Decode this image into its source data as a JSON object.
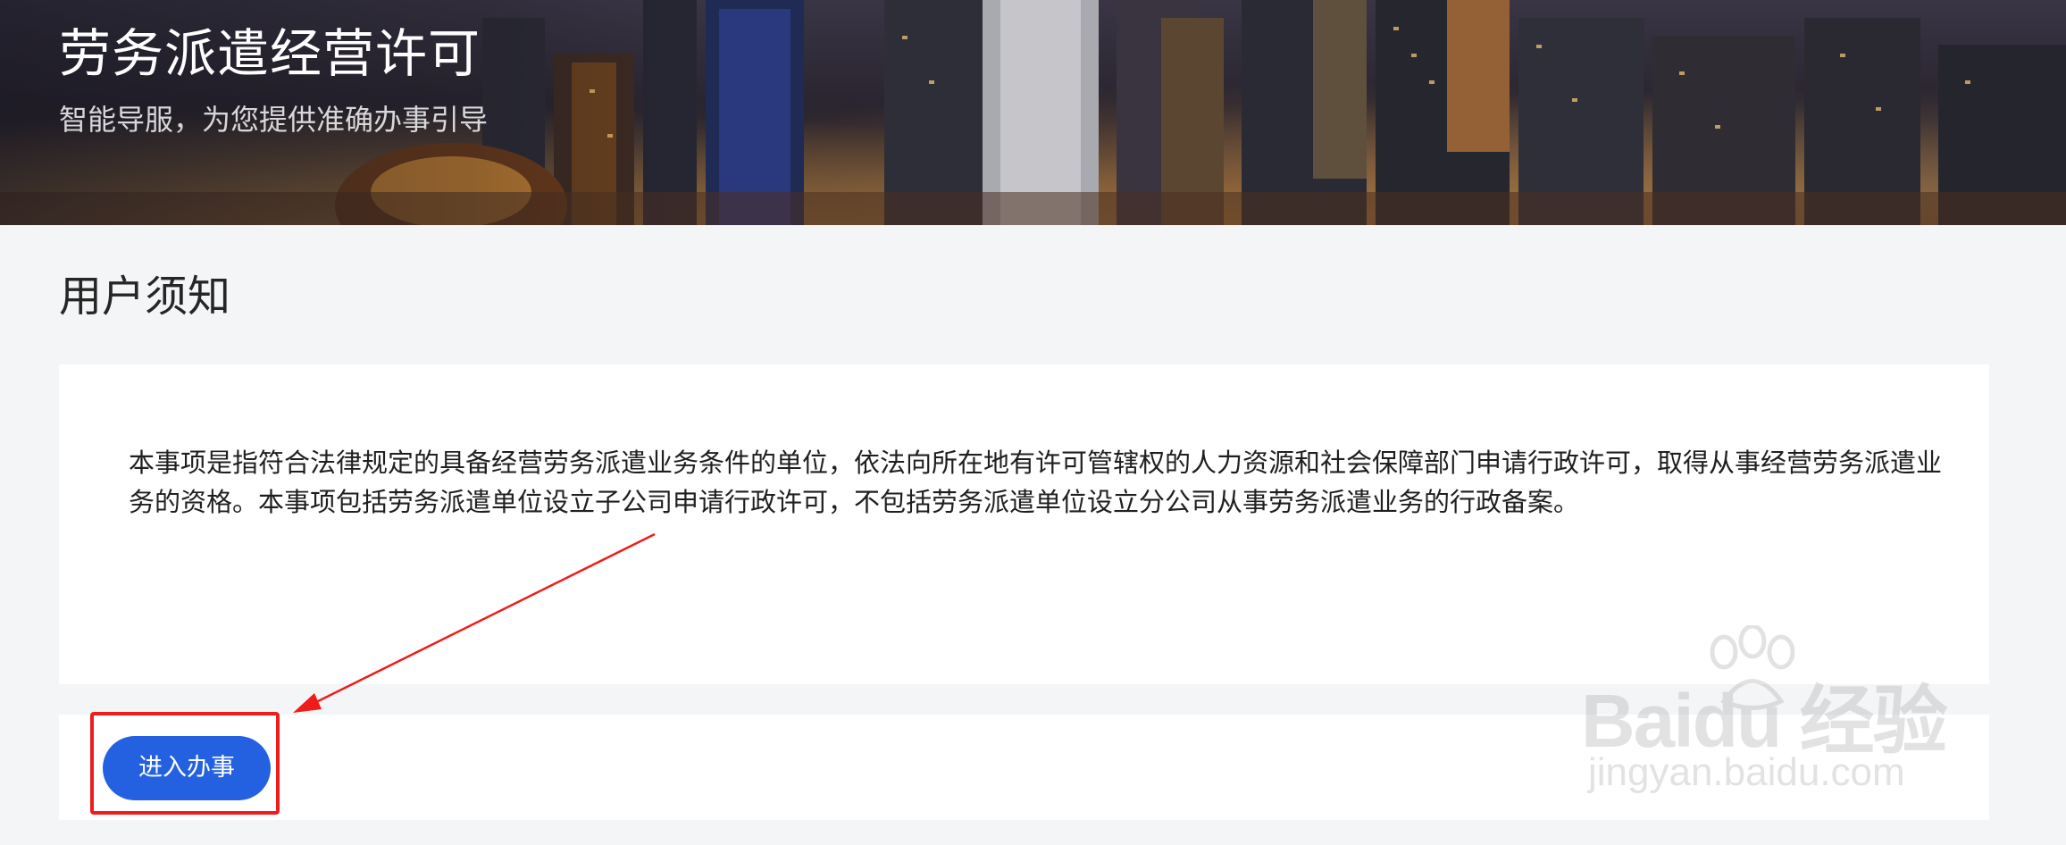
{
  "hero": {
    "title": "劳务派遣经营许可",
    "subtitle": "智能导服，为您提供准确办事引导"
  },
  "notice": {
    "section_title": "用户须知",
    "text": "本事项是指符合法律规定的具备经营劳务派遣业务条件的单位，依法向所在地有许可管辖权的人力资源和社会保障部门申请行政许可，取得从事经营劳务派遣业务的资格。本事项包括劳务派遣单位设立子公司申请行政许可，不包括劳务派遣单位设立分公司从事劳务派遣业务的行政备案。"
  },
  "actions": {
    "enter_label": "进入办事"
  },
  "watermark": {
    "brand": "Baidu 经验",
    "url": "jingyan.baidu.com"
  },
  "colors": {
    "primary_button": "#2461e0",
    "annotation_red": "#ef1c1c",
    "page_background": "#f4f5f7"
  },
  "icons": [
    "baidu-paw-icon"
  ]
}
